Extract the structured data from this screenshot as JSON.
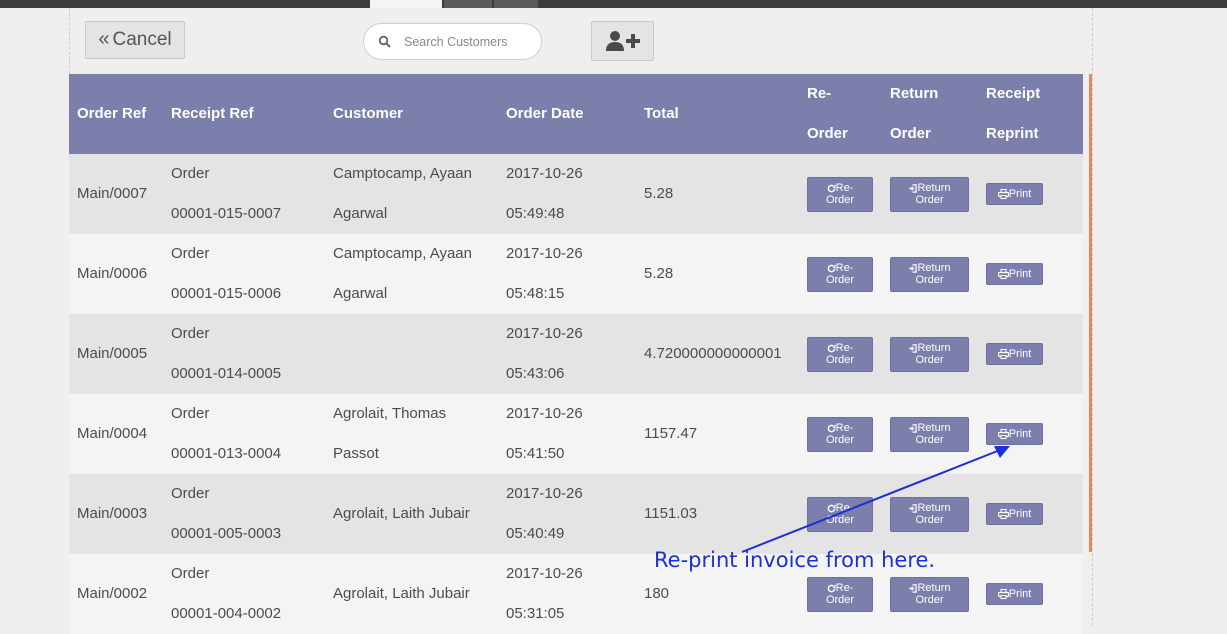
{
  "toolbar": {
    "cancel_label": "Cancel",
    "search_placeholder": "Search Customers"
  },
  "table": {
    "headers": {
      "order_ref": "Order Ref",
      "receipt_ref": "Receipt Ref",
      "customer": "Customer",
      "order_date": "Order Date",
      "total": "Total",
      "reorder_line1": "Re-",
      "reorder_line2": "Order",
      "return_line1": "Return",
      "return_line2": "Order",
      "receipt_line1": "Receipt",
      "receipt_line2": "Reprint"
    },
    "buttons": {
      "reorder_line1": "Re-",
      "reorder_line2": "Order",
      "return_line1": "Return",
      "return_line2": "Order",
      "print": "Print"
    },
    "rows": [
      {
        "order_ref": "Main/0007",
        "receipt_line1": "Order",
        "receipt_line2": "00001-015-0007",
        "customer_line1": "Camptocamp, Ayaan",
        "customer_line2": "Agarwal",
        "date_line1": "2017-10-26",
        "date_line2": "05:49:48",
        "total": "5.28"
      },
      {
        "order_ref": "Main/0006",
        "receipt_line1": "Order",
        "receipt_line2": "00001-015-0006",
        "customer_line1": "Camptocamp, Ayaan",
        "customer_line2": "Agarwal",
        "date_line1": "2017-10-26",
        "date_line2": "05:48:15",
        "total": "5.28"
      },
      {
        "order_ref": "Main/0005",
        "receipt_line1": "Order",
        "receipt_line2": "00001-014-0005",
        "customer_line1": "",
        "customer_line2": "",
        "date_line1": "2017-10-26",
        "date_line2": "05:43:06",
        "total": "4.720000000000001"
      },
      {
        "order_ref": "Main/0004",
        "receipt_line1": "Order",
        "receipt_line2": "00001-013-0004",
        "customer_line1": "Agrolait, Thomas",
        "customer_line2": "Passot",
        "date_line1": "2017-10-26",
        "date_line2": "05:41:50",
        "total": "1157.47"
      },
      {
        "order_ref": "Main/0003",
        "receipt_line1": "Order",
        "receipt_line2": "00001-005-0003",
        "customer_line1": "Agrolait, Laith Jubair",
        "customer_line2": "",
        "date_line1": "2017-10-26",
        "date_line2": "05:40:49",
        "total": "1151.03"
      },
      {
        "order_ref": "Main/0002",
        "receipt_line1": "Order",
        "receipt_line2": "00001-004-0002",
        "customer_line1": "Agrolait, Laith Jubair",
        "customer_line2": "",
        "date_line1": "2017-10-26",
        "date_line2": "05:31:05",
        "total": "180"
      }
    ]
  },
  "annotation": {
    "text": "Re-print invoice from here.",
    "color": "#1a2fd6"
  },
  "colors": {
    "header_bg": "#7c7fac",
    "accent_orange": "#e8875a"
  }
}
